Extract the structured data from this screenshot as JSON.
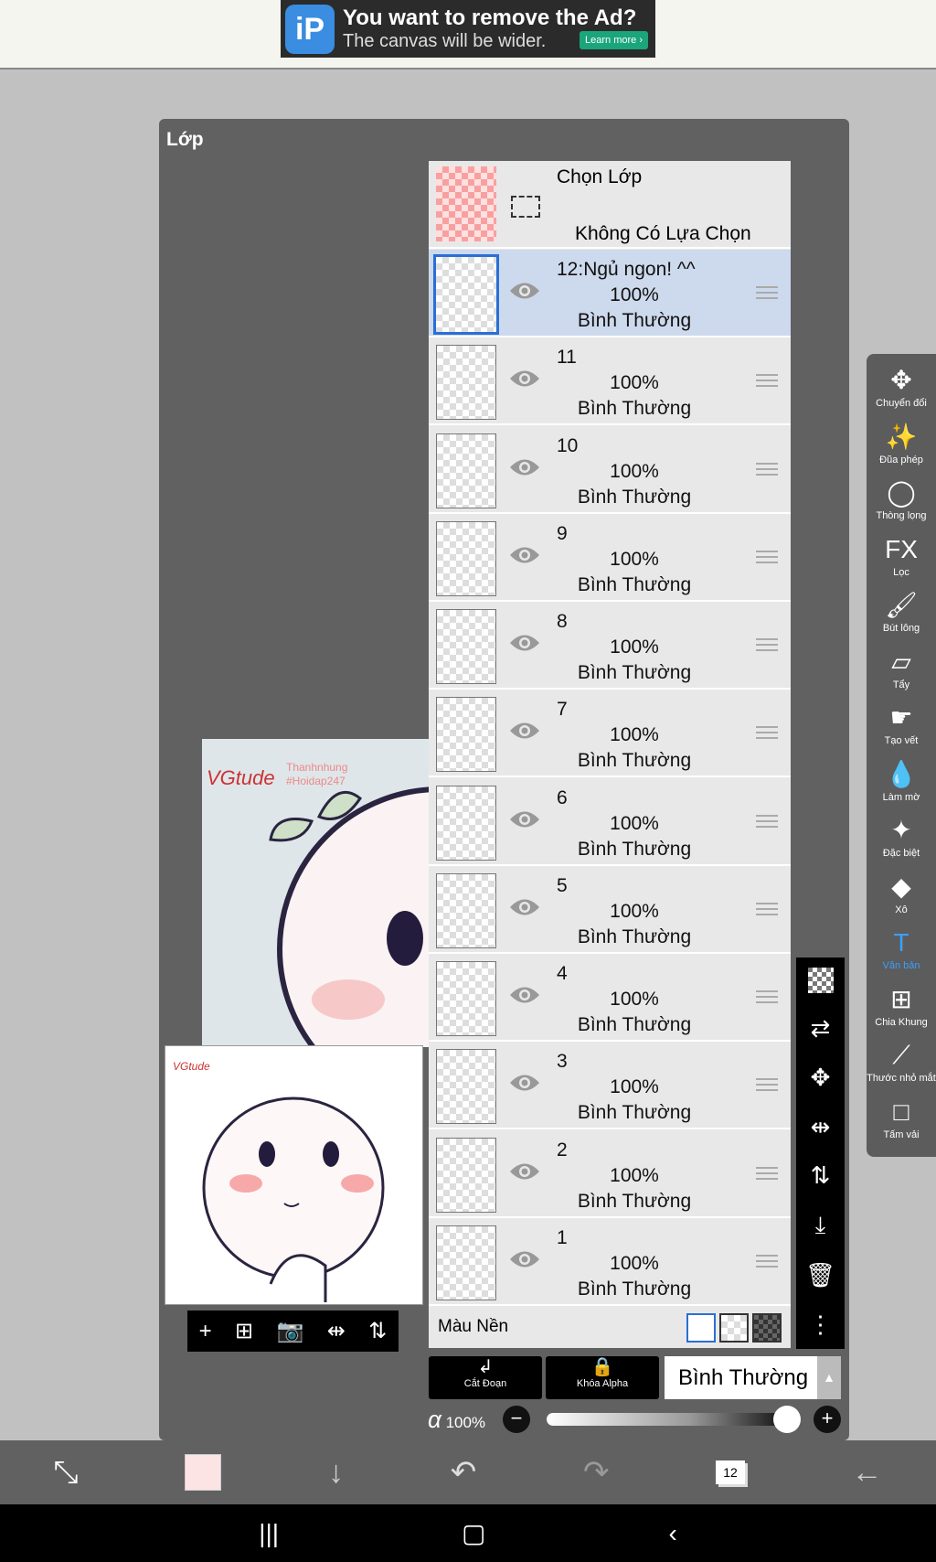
{
  "ad": {
    "title": "You want to remove the Ad?",
    "subtitle": "The canvas will be wider.",
    "button": "Learn more ›",
    "logo": "iP"
  },
  "panel": {
    "title": "Lớp"
  },
  "select_layer": {
    "title": "Chọn Lớp",
    "status": "Không Có Lựa Chọn"
  },
  "layers": [
    {
      "name": "12:Ngủ ngon! ^^",
      "opacity": "100%",
      "blend": "Bình Thường",
      "selected": true
    },
    {
      "name": "11",
      "opacity": "100%",
      "blend": "Bình Thường"
    },
    {
      "name": "10",
      "opacity": "100%",
      "blend": "Bình Thường"
    },
    {
      "name": "9",
      "opacity": "100%",
      "blend": "Bình Thường"
    },
    {
      "name": "8",
      "opacity": "100%",
      "blend": "Bình Thường"
    },
    {
      "name": "7",
      "opacity": "100%",
      "blend": "Bình Thường"
    },
    {
      "name": "6",
      "opacity": "100%",
      "blend": "Bình Thường"
    },
    {
      "name": "5",
      "opacity": "100%",
      "blend": "Bình Thường"
    },
    {
      "name": "4",
      "opacity": "100%",
      "blend": "Bình Thường"
    },
    {
      "name": "3",
      "opacity": "100%",
      "blend": "Bình Thường"
    },
    {
      "name": "2",
      "opacity": "100%",
      "blend": "Bình Thường"
    },
    {
      "name": "1",
      "opacity": "100%",
      "blend": "Bình Thường"
    }
  ],
  "background": {
    "label": "Màu Nền",
    "selected": "white"
  },
  "buttons": {
    "clip": "Cắt Đoạn",
    "alpha_lock": "Khóa Alpha",
    "blend_mode": "Bình Thường"
  },
  "alpha": {
    "symbol": "α",
    "value": "100%",
    "fraction": 1.0
  },
  "canvas_text": {
    "sig": "VGtude",
    "line1": "Thanhnhung",
    "line2": "#Hoidap247"
  },
  "tools": [
    {
      "label": "Chuyển đổi",
      "icon": "move-icon"
    },
    {
      "label": "Đũa phép",
      "icon": "magic-wand-icon"
    },
    {
      "label": "Thòng lọng",
      "icon": "lasso-icon"
    },
    {
      "label": "Lọc",
      "icon": "fx-icon"
    },
    {
      "label": "Bút lông",
      "icon": "brush-icon"
    },
    {
      "label": "Tẩy",
      "icon": "eraser-icon"
    },
    {
      "label": "Tạo vết",
      "icon": "smudge-icon"
    },
    {
      "label": "Làm mờ",
      "icon": "blur-icon"
    },
    {
      "label": "Đặc biệt",
      "icon": "special-icon"
    },
    {
      "label": "Xô",
      "icon": "bucket-icon"
    },
    {
      "label": "Văn bản",
      "icon": "text-icon",
      "active": true
    },
    {
      "label": "Chia Khung",
      "icon": "frame-divider-icon"
    },
    {
      "label": "Thước nhỏ mắt",
      "icon": "eyedropper-icon"
    },
    {
      "label": "Tấm vải",
      "icon": "canvas-icon"
    }
  ],
  "bottom": {
    "layer_count": "12",
    "color": "#fde4e4"
  },
  "colors": {
    "accent": "#2a6fd6",
    "selected_row": "#cdd9ec",
    "active_tool": "#3aa0ff"
  }
}
